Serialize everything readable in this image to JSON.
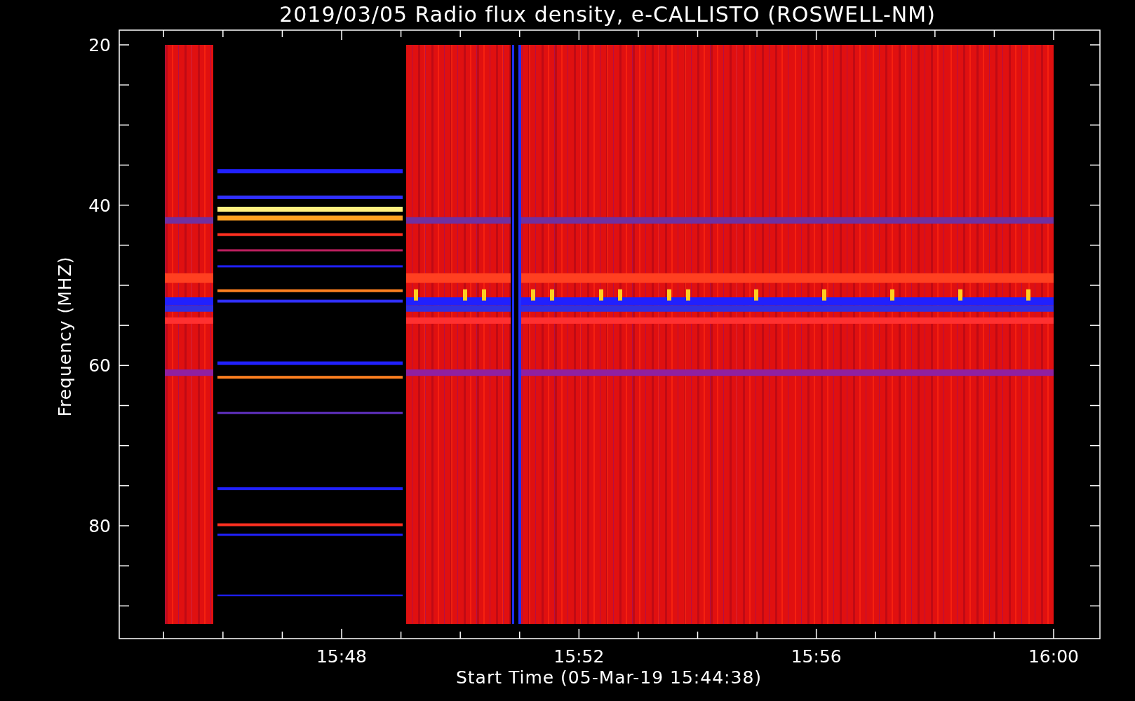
{
  "title": "2019/03/05  Radio flux density, e-CALLISTO (ROSWELL-NM)",
  "y_axis": {
    "label": "Frequency (MHZ)",
    "ticks": [
      "20",
      "40",
      "60",
      "80"
    ]
  },
  "x_axis": {
    "label": "Start Time (05-Mar-19 15:44:38)",
    "ticks": [
      "15:48",
      "15:52",
      "15:56",
      "16:00"
    ]
  }
}
